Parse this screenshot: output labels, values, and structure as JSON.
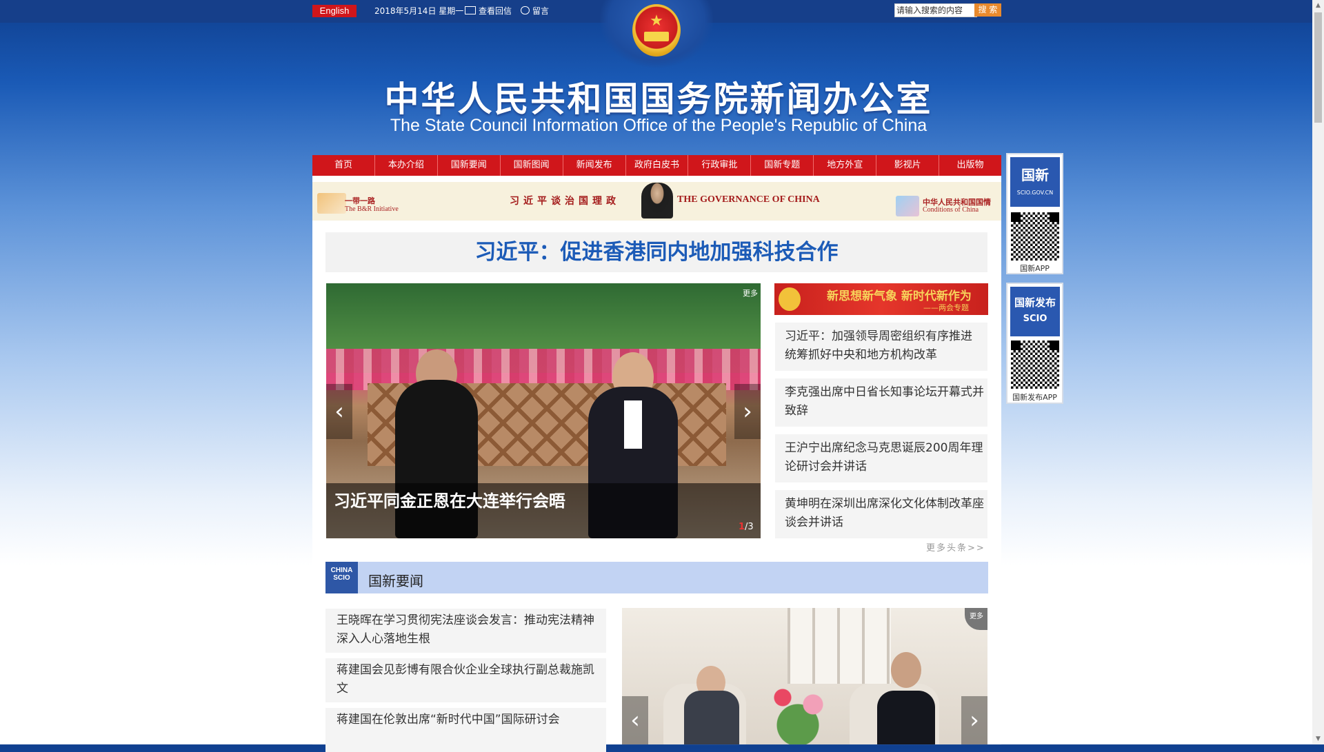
{
  "topbar": {
    "lang_button": "English",
    "date": "2018年5月14日 星期一",
    "link_reply": "查看回信",
    "link_message": "留言",
    "search_placeholder": "请输入搜索的内容",
    "search_button": "搜 索"
  },
  "header": {
    "title_cn": "中华人民共和国国务院新闻办公室",
    "title_en": "The State Council Information Office of the People's Republic of China"
  },
  "nav": {
    "items": [
      "首页",
      "本办介绍",
      "国新要闻",
      "国新图闻",
      "新闻发布",
      "政府白皮书",
      "行政审批",
      "国新专题",
      "地方外宣",
      "影视片",
      "出版物"
    ]
  },
  "banner": {
    "left_cn": "一带一路",
    "left_en": "The B&R Initiative",
    "center_cn": "习近平谈治国理政",
    "center_en": "THE GOVERNANCE OF CHINA",
    "right_cn": "中华人民共和国国情",
    "right_en": "Conditions of China"
  },
  "headline": "习近平：促进香港同内地加强科技合作",
  "slideshow": {
    "caption": "习近平同金正恩在大连举行会晤",
    "current": "1",
    "total": "/3",
    "more": "更多"
  },
  "special_banner": {
    "title": "新思想新气象 新时代新作为",
    "subtitle": "——两会专题"
  },
  "right_news": [
    "习近平：加强领导周密组织有序推进 统筹抓好中央和地方机构改革",
    "李克强出席中日省长知事论坛开幕式并致辞",
    "王沪宁出席纪念马克思诞辰200周年理论研讨会并讲话",
    "黄坤明在深圳出席深化文化体制改革座谈会并讲话"
  ],
  "more_link": "更多头条>>",
  "section": {
    "logo_line1": "CHINA",
    "logo_line2": "SCIO",
    "title": "国新要闻"
  },
  "section_list": [
    "王晓晖在学习贯彻宪法座谈会发言：推动宪法精神深入人心落地生根",
    "蒋建国会见彭博有限合伙企业全球执行副总裁施凯文",
    "蒋建国在伦敦出席“新时代中国”国际研讨会"
  ],
  "photo2": {
    "more": "更多"
  },
  "side_widgets": [
    {
      "logo": "国新",
      "domain": "SCIO.GOV.CN",
      "caption": "国新APP"
    },
    {
      "logo": "国新发布",
      "domain": "SCIO",
      "caption": "国新发布APP"
    }
  ],
  "colors": {
    "nav_red": "#d0161b",
    "headline_blue": "#1c5bb7",
    "section_bar": "#c2d3f3",
    "top_bar": "#163f8a"
  }
}
